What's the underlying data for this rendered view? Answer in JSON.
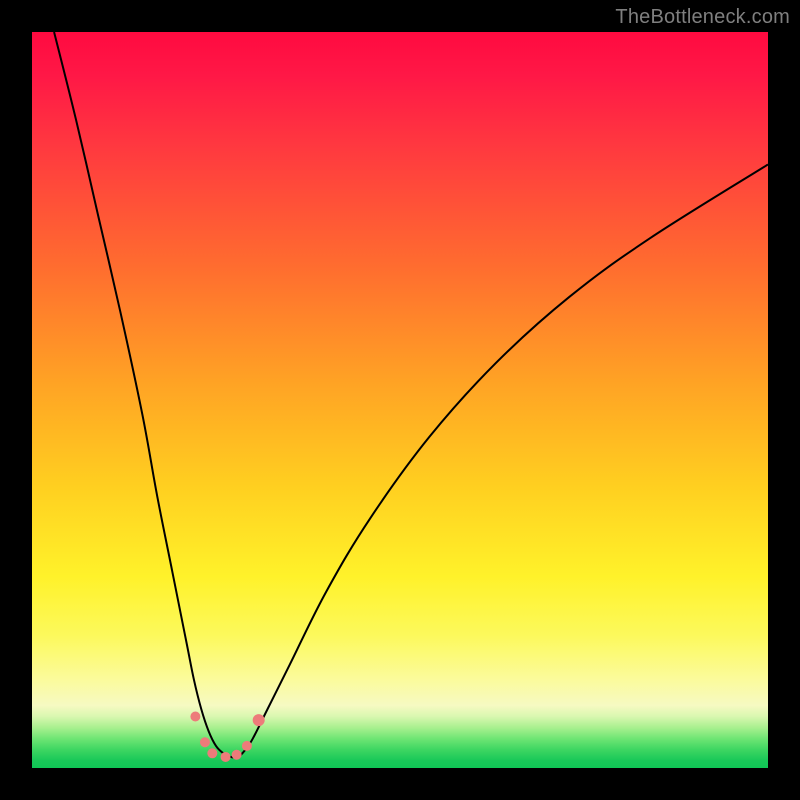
{
  "watermark": "TheBottleneck.com",
  "colors": {
    "page_bg": "#000000",
    "watermark": "#7f7f7f",
    "curve_stroke": "#000000",
    "marker_fill": "#ed7b7a",
    "gradient_stops": [
      "#ff0a40",
      "#ff1846",
      "#ff3a3f",
      "#ff6d2f",
      "#ffa424",
      "#ffd020",
      "#fff22a",
      "#fcf95c",
      "#fbfb9c",
      "#f6fac2",
      "#d9f7b0",
      "#a9f08f",
      "#6fe574",
      "#3ed662",
      "#18c858",
      "#10c656"
    ]
  },
  "chart_data": {
    "type": "line",
    "title": "",
    "xlabel": "",
    "ylabel": "",
    "xlim": [
      0,
      100
    ],
    "ylim": [
      0,
      100
    ],
    "grid": false,
    "legend": false,
    "comment": "Bottleneck-style V-curve. x is a normalized hardware-balance axis (0–100, no visible ticks). y is percent bottleneck (0 at bottom = no bottleneck, 100 at top = full bottleneck). Left branch starts off-chart near x≈3, descends steeply to a flat minimum around x≈24–30, then a gentler right branch rises to the upper-right, ending near y≈82 at x=100. Salmon markers sit along the flat bottom of the valley.",
    "series": [
      {
        "name": "bottleneck-curve",
        "x": [
          3,
          6,
          9,
          12,
          15,
          17,
          19,
          21,
          22,
          23,
          24,
          25,
          26,
          27,
          28,
          29,
          30,
          32,
          35,
          40,
          46,
          54,
          63,
          73,
          84,
          100
        ],
        "y": [
          100,
          88,
          75,
          62,
          48,
          37,
          27,
          17,
          12,
          8,
          5,
          3,
          2,
          1.5,
          1.5,
          2.5,
          4,
          8,
          14,
          24,
          34,
          45,
          55,
          64,
          72,
          82
        ]
      }
    ],
    "markers": {
      "name": "highlight-points",
      "x": [
        22.2,
        23.5,
        24.5,
        26.3,
        27.8,
        29.2,
        30.8
      ],
      "y": [
        7,
        3.5,
        2,
        1.5,
        1.8,
        3,
        6.5
      ],
      "r": [
        5,
        5,
        5,
        5,
        5,
        5,
        6
      ]
    }
  }
}
